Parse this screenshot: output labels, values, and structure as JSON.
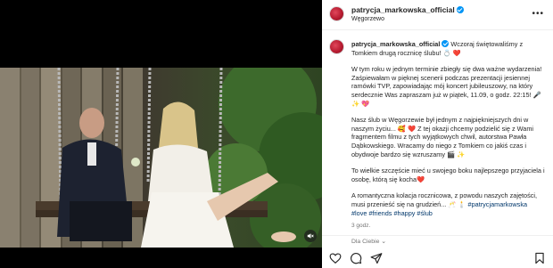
{
  "post": {
    "author": "patrycja_markowska_official",
    "location": "Węgorzewo",
    "more_icon": "more-horizontal-icon"
  },
  "caption": {
    "author": "patrycja_markowska_official",
    "paragraphs": [
      "Wczoraj świętowaliśmy z Tomkiem drugą rocznicę ślubu! 💍 ❤️",
      "W tym roku w jednym terminie zbiegły się dwa ważne wydarzenia! Zaśpiewałam w pięknej scenerii podczas prezentacji jesiennej ramówki TVP, zapowiadając mój koncert jubileuszowy, na który serdecznie Was zapraszam już w piątek, 11.09, o godz. 22:15! 🎤 ✨ 💖",
      "Nasz ślub w Węgorzewie był jednym z najpiękniejszych dni w naszym życiu... 🥰 ❤️ Z tej okazji chcemy podzielić się z Wami fragmentem filmu z tych wyjątkowych chwil, autorstwa Pawła Dąbkowskiego. Wracamy do niego z Tomkiem co jakiś czas i obydwoje bardzo się wzruszamy 🎬 ✨",
      "To wielkie szczęście mieć u swojego boku najlepszego przyjaciela i osobę, którą się kocha❤️",
      "A romantyczna kolacja rocznicowa, z powodu naszych zajętości, musi przenieść się na grudzień... 🥂 🕯️"
    ],
    "last_tags": "#patrycjamarkowska",
    "hashtags": "#love #friends #happy #ślub",
    "time_ago": "3 godz."
  },
  "footer": {
    "liked_by": "Dla Ciebie ⌄"
  },
  "icons": {
    "like": "heart-icon",
    "comment": "comment-icon",
    "share": "share-icon",
    "save": "bookmark-icon",
    "mute": "volume-muted-icon"
  }
}
